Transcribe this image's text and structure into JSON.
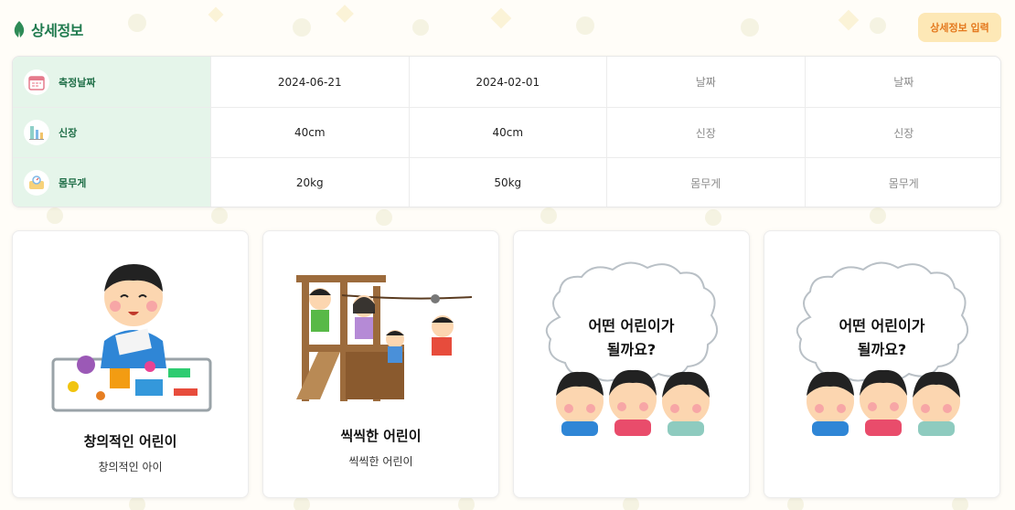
{
  "header": {
    "title": "상세정보",
    "input_button_label": "상세정보 입력"
  },
  "table": {
    "rows": [
      {
        "label": "측정날짜",
        "icon": "calendar-icon",
        "cells": [
          {
            "text": "2024-06-21",
            "placeholder": false
          },
          {
            "text": "2024-02-01",
            "placeholder": false
          },
          {
            "text": "날짜",
            "placeholder": true
          },
          {
            "text": "날짜",
            "placeholder": true
          }
        ]
      },
      {
        "label": "신장",
        "icon": "height-chart-icon",
        "cells": [
          {
            "text": "40cm",
            "placeholder": false
          },
          {
            "text": "40cm",
            "placeholder": false
          },
          {
            "text": "신장",
            "placeholder": true
          },
          {
            "text": "신장",
            "placeholder": true
          }
        ]
      },
      {
        "label": "몸무게",
        "icon": "scale-icon",
        "cells": [
          {
            "text": "20kg",
            "placeholder": false
          },
          {
            "text": "50kg",
            "placeholder": false
          },
          {
            "text": "몸무게",
            "placeholder": true
          },
          {
            "text": "몸무게",
            "placeholder": true
          }
        ]
      }
    ]
  },
  "cards": [
    {
      "title": "창의적인 어린이",
      "subtitle": "창의적인 아이",
      "illustration": "child-crafting-illustration"
    },
    {
      "title": "씩씩한 어린이",
      "subtitle": "씩씩한 어린이",
      "illustration": "children-playground-illustration"
    },
    {
      "bubble_line1": "어떤 어린이가",
      "bubble_line2": "될까요?",
      "illustration": "three-children-thought-bubble-illustration"
    },
    {
      "bubble_line1": "어떤 어린이가",
      "bubble_line2": "될까요?",
      "illustration": "three-children-thought-bubble-illustration"
    }
  ],
  "colors": {
    "brand_green": "#1f7a4e",
    "row_header_bg": "#e5f5ea",
    "button_bg": "#fde8b6",
    "button_text": "#e4791e"
  }
}
